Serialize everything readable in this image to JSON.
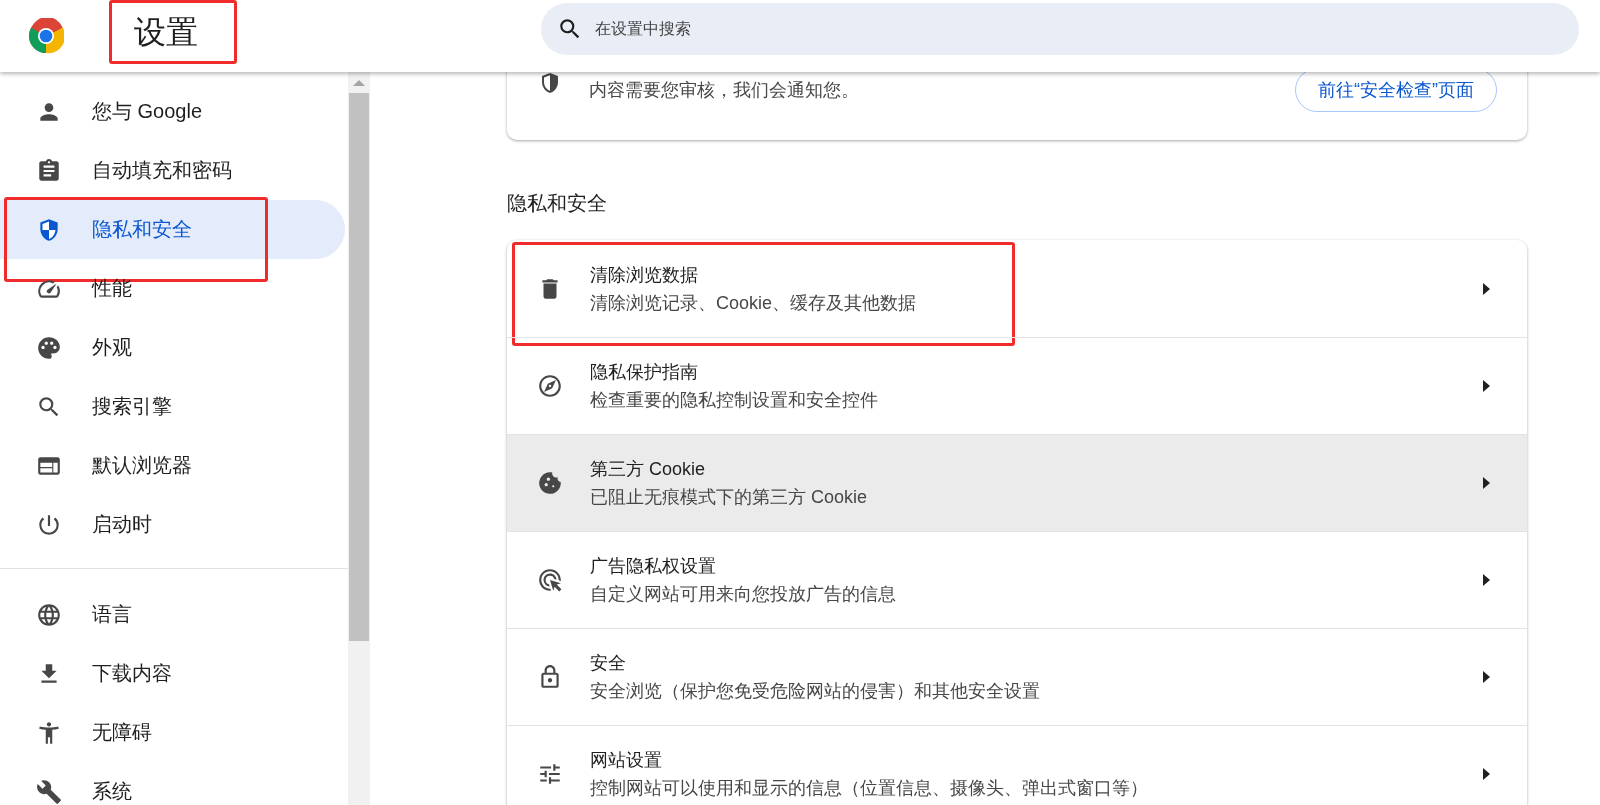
{
  "header": {
    "title": "设置",
    "title_highlighted": true,
    "search": {
      "placeholder": "在设置中搜索"
    }
  },
  "sidebar": {
    "items": [
      {
        "label": "您与 Google",
        "selected": false,
        "highlighted": false
      },
      {
        "label": "自动填充和密码",
        "selected": false,
        "highlighted": false
      },
      {
        "label": "隐私和安全",
        "selected": true,
        "highlighted": true
      },
      {
        "label": "性能",
        "selected": false,
        "highlighted": false
      },
      {
        "label": "外观",
        "selected": false,
        "highlighted": false
      },
      {
        "label": "搜索引擎",
        "selected": false,
        "highlighted": false
      },
      {
        "label": "默认浏览器",
        "selected": false,
        "highlighted": false
      },
      {
        "label": "启动时",
        "selected": false,
        "highlighted": false
      },
      {
        "label": "语言",
        "selected": false,
        "highlighted": false
      },
      {
        "label": "下载内容",
        "selected": false,
        "highlighted": false
      },
      {
        "label": "无障碍",
        "selected": false,
        "highlighted": false
      },
      {
        "label": "系统",
        "selected": false,
        "highlighted": false
      }
    ]
  },
  "safety_card": {
    "text": "内容需要您审核，我们会通知您。",
    "button": "前往“安全检查”页面"
  },
  "section": {
    "title": "隐私和安全",
    "rows": [
      {
        "title": "清除浏览数据",
        "subtitle": "清除浏览记录、Cookie、缓存及其他数据",
        "hovered": false,
        "highlighted": true
      },
      {
        "title": "隐私保护指南",
        "subtitle": "检查重要的隐私控制设置和安全控件",
        "hovered": false,
        "highlighted": false
      },
      {
        "title": "第三方 Cookie",
        "subtitle": "已阻止无痕模式下的第三方 Cookie",
        "hovered": true,
        "highlighted": false
      },
      {
        "title": "广告隐私权设置",
        "subtitle": "自定义网站可用来向您投放广告的信息",
        "hovered": false,
        "highlighted": false
      },
      {
        "title": "安全",
        "subtitle": "安全浏览（保护您免受危险网站的侵害）和其他安全设置",
        "hovered": false,
        "highlighted": false
      },
      {
        "title": "网站设置",
        "subtitle": "控制网站可以使用和显示的信息（位置信息、摄像头、弹出式窗口等）",
        "hovered": false,
        "highlighted": false
      }
    ]
  }
}
